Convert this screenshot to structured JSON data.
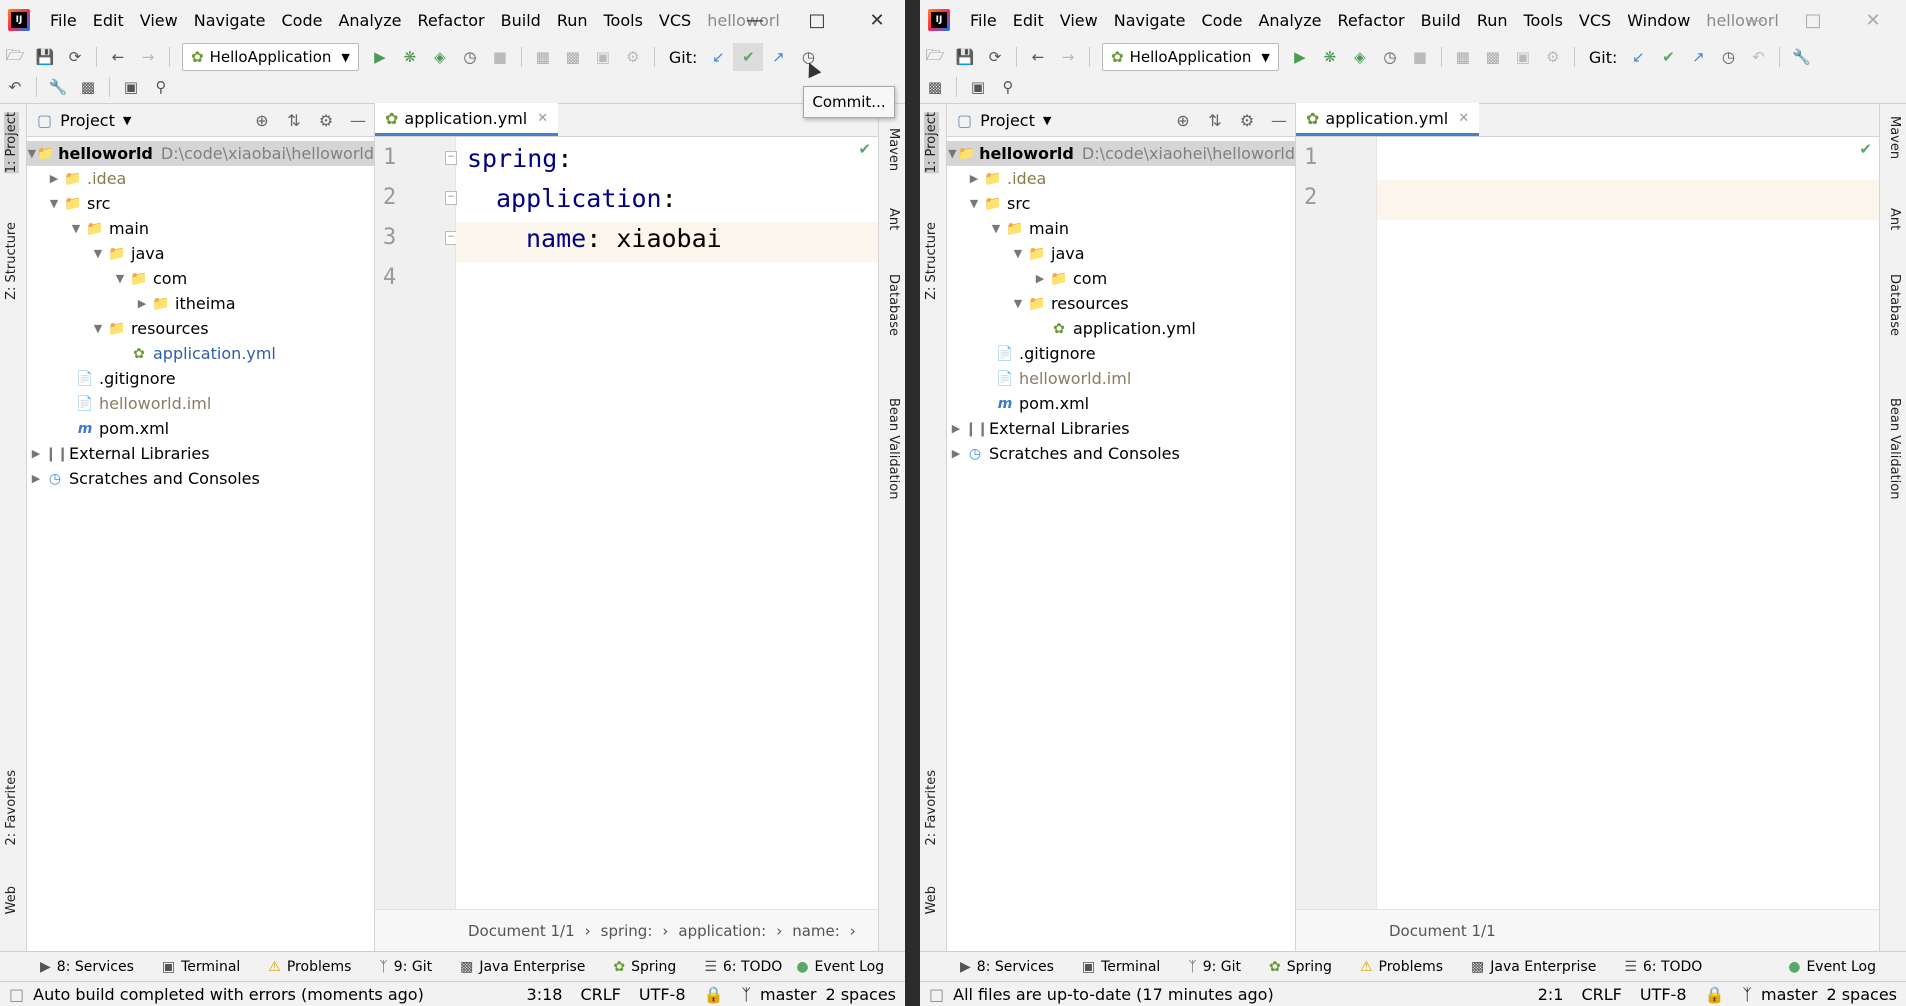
{
  "left": {
    "menu": [
      "File",
      "Edit",
      "View",
      "Navigate",
      "Code",
      "Analyze",
      "Refactor",
      "Build",
      "Run",
      "Tools",
      "VCS"
    ],
    "window_title": "helloworl",
    "run_config": "HelloApplication",
    "git_label": "Git:",
    "popup": "Commit...",
    "project_header": "Project",
    "tree": [
      {
        "name": "helloworld",
        "path": "D:\\code\\xiaobai\\helloworld"
      },
      {
        "name": ".idea"
      },
      {
        "name": "src"
      },
      {
        "name": "main"
      },
      {
        "name": "java"
      },
      {
        "name": "com"
      },
      {
        "name": "itheima"
      },
      {
        "name": "resources"
      },
      {
        "name": "application.yml"
      },
      {
        "name": ".gitignore"
      },
      {
        "name": "helloworld.iml"
      },
      {
        "name": "pom.xml"
      },
      {
        "name": "External Libraries"
      },
      {
        "name": "Scratches and Consoles"
      }
    ],
    "editor_tab": "application.yml",
    "line_numbers": [
      "1",
      "2",
      "3",
      "4"
    ],
    "code": {
      "l1_key": "spring",
      "l2_key": "application",
      "l3_key": "name",
      "l3_value": "xiaobai",
      "colon": ":"
    },
    "breadcrumb": [
      "Document 1/1",
      "spring:",
      "application:",
      "name:"
    ],
    "vtabs_left": [
      "1: Project",
      "Z: Structure",
      "2: Favorites",
      "Web"
    ],
    "vtabs_right": [
      "Maven",
      "Ant",
      "Database",
      "Bean Validation"
    ],
    "bottom_tools": [
      "8: Services",
      "Terminal",
      "Problems",
      "9: Git",
      "Java Enterprise",
      "Spring",
      "6: TODO",
      "Event Log"
    ],
    "status": {
      "message": "Auto build completed with errors (moments ago)",
      "pos": "3:18",
      "eol": "CRLF",
      "enc": "UTF-8",
      "branch": "master",
      "indent": "2 spaces"
    }
  },
  "right": {
    "menu": [
      "File",
      "Edit",
      "View",
      "Navigate",
      "Code",
      "Analyze",
      "Refactor",
      "Build",
      "Run",
      "Tools",
      "VCS",
      "Window"
    ],
    "window_title": "helloworl",
    "run_config": "HelloApplication",
    "git_label": "Git:",
    "project_header": "Project",
    "tree": [
      {
        "name": "helloworld",
        "path": "D:\\code\\xiaohei\\helloworld"
      },
      {
        "name": ".idea"
      },
      {
        "name": "src"
      },
      {
        "name": "main"
      },
      {
        "name": "java"
      },
      {
        "name": "com"
      },
      {
        "name": "resources"
      },
      {
        "name": "application.yml"
      },
      {
        "name": ".gitignore"
      },
      {
        "name": "helloworld.iml"
      },
      {
        "name": "pom.xml"
      },
      {
        "name": "External Libraries"
      },
      {
        "name": "Scratches and Consoles"
      }
    ],
    "editor_tab": "application.yml",
    "line_numbers": [
      "1",
      "2"
    ],
    "breadcrumb": [
      "Document 1/1"
    ],
    "vtabs_left": [
      "1: Project",
      "Z: Structure",
      "2: Favorites",
      "Web"
    ],
    "vtabs_right": [
      "Maven",
      "Ant",
      "Database",
      "Bean Validation"
    ],
    "bottom_tools": [
      "8: Services",
      "Terminal",
      "9: Git",
      "Spring",
      "Problems",
      "Java Enterprise",
      "6: TODO",
      "Event Log"
    ],
    "status": {
      "message": "All files are up-to-date (17 minutes ago)",
      "pos": "2:1",
      "eol": "CRLF",
      "enc": "UTF-8",
      "branch": "master",
      "indent": "2 spaces"
    }
  },
  "colors": {
    "keyword": "#000080",
    "spring_leaf": "#6a9b3a",
    "git_check": "#59a869",
    "selection": "#d5d5d5"
  }
}
